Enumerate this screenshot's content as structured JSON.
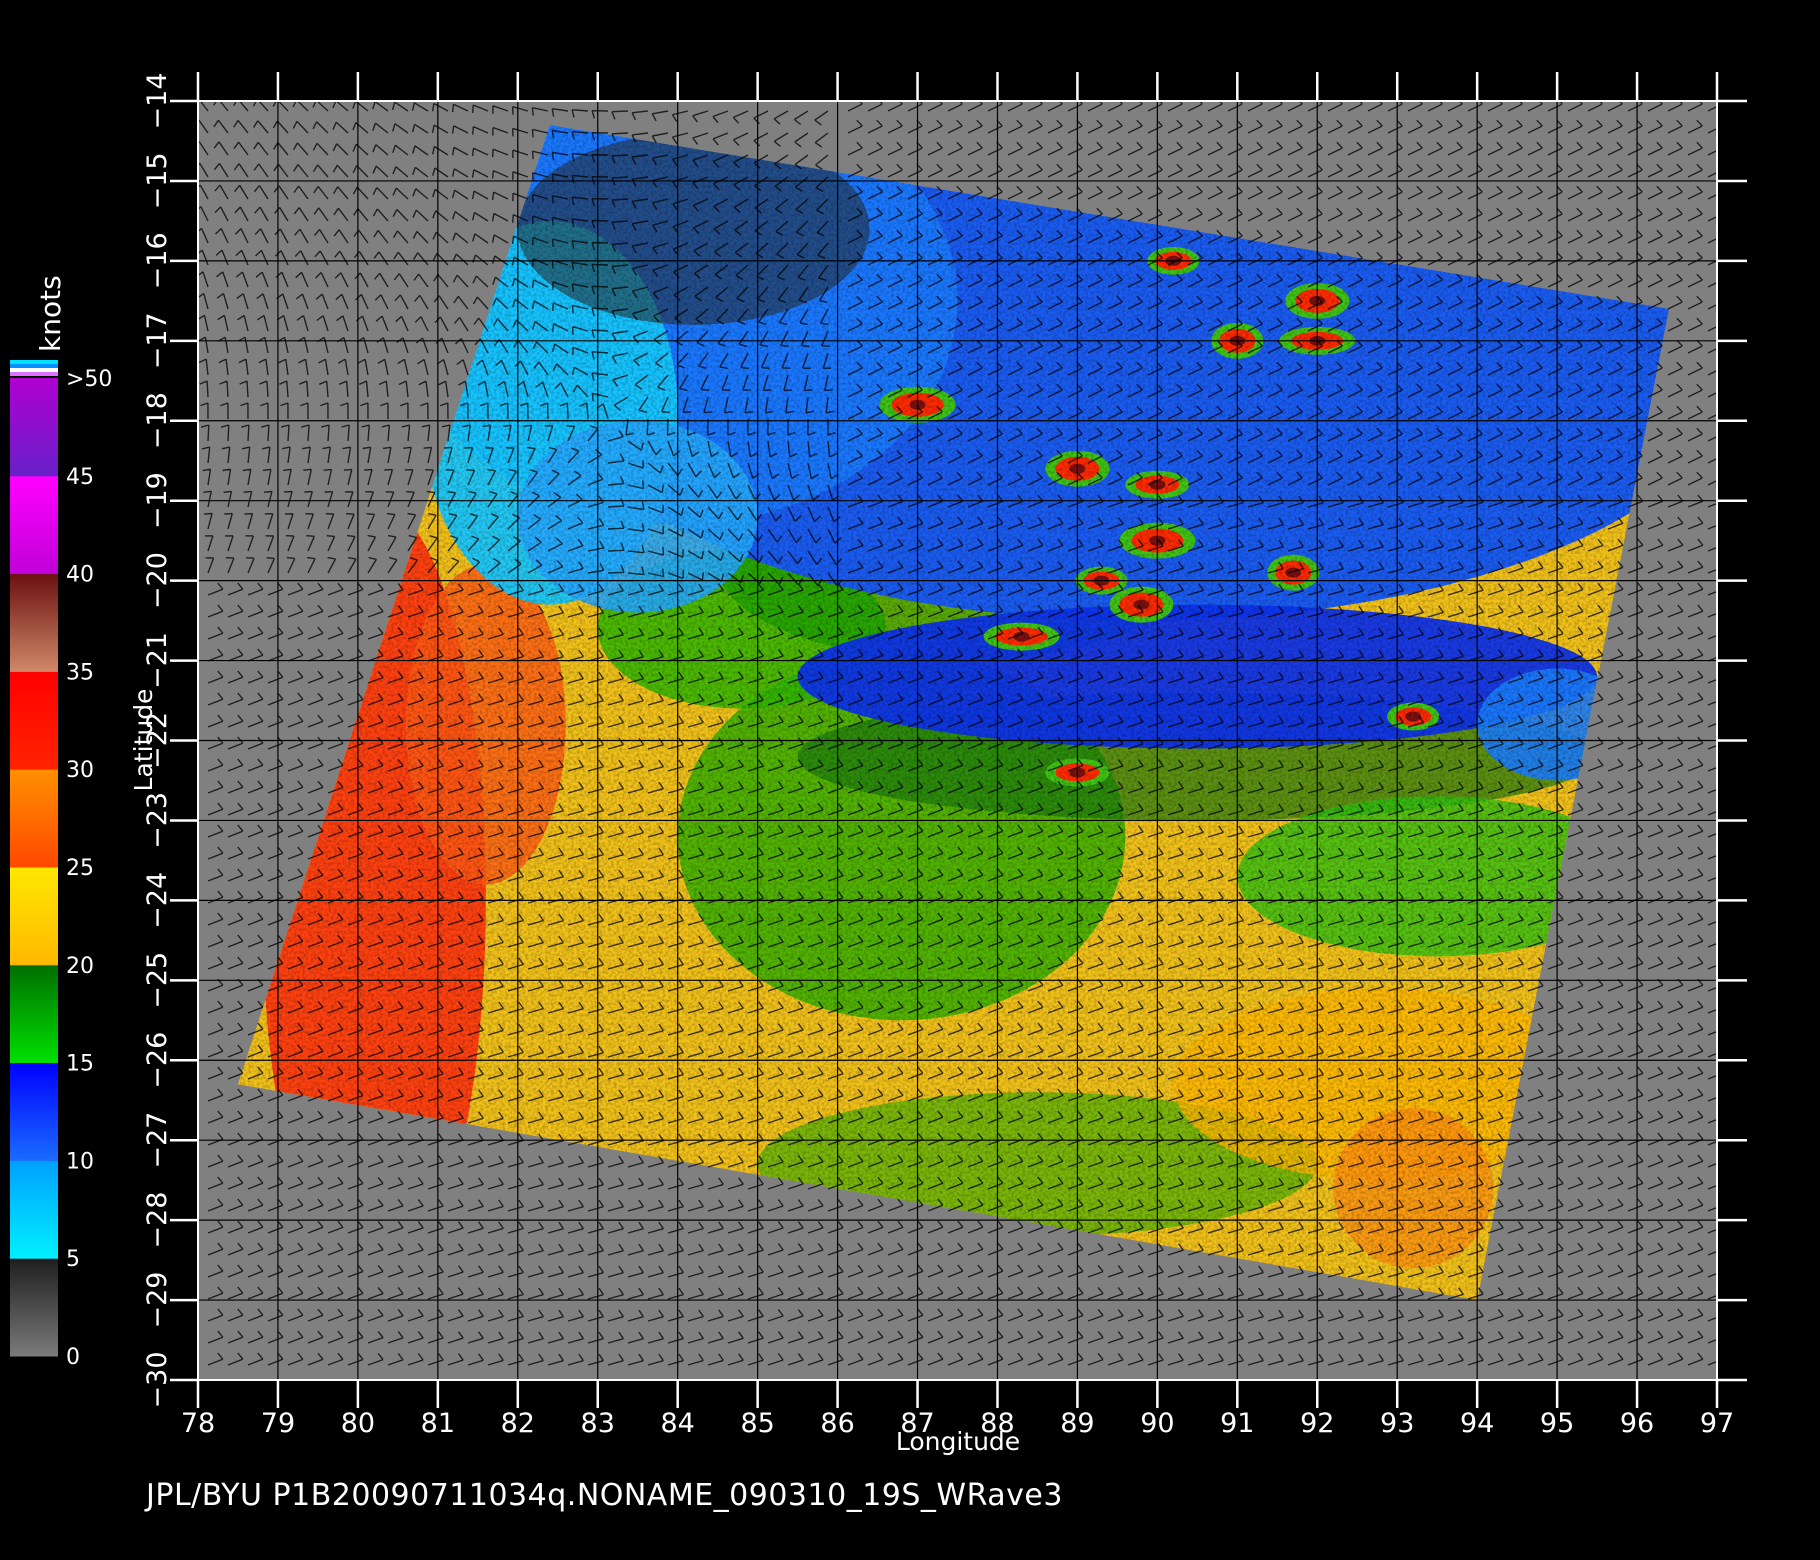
{
  "map": {
    "lon_range": [
      78,
      97
    ],
    "lat_range": [
      -14,
      -30
    ],
    "lon_ticks": [
      78,
      79,
      80,
      81,
      82,
      83,
      84,
      85,
      86,
      87,
      88,
      89,
      90,
      91,
      92,
      93,
      94,
      95,
      96,
      97
    ],
    "lat_ticks": [
      -14,
      -15,
      -16,
      -17,
      -18,
      -19,
      -20,
      -21,
      -22,
      -23,
      -24,
      -25,
      -26,
      -27,
      -28,
      -29,
      -30
    ],
    "lon_tick_labels": [
      "78",
      "79",
      "80",
      "81",
      "82",
      "83",
      "84",
      "85",
      "86",
      "87",
      "88",
      "89",
      "90",
      "91",
      "92",
      "93",
      "94",
      "95",
      "96",
      "97"
    ],
    "lat_tick_labels": [
      "−14",
      "−15",
      "−16",
      "−17",
      "−18",
      "−19",
      "−20",
      "−21",
      "−22",
      "−23",
      "−24",
      "−25",
      "−26",
      "−27",
      "−28",
      "−29",
      "−30"
    ],
    "xlabel": "Longitude",
    "ylabel": "Latitude",
    "background_color": "#808080",
    "swath_corners_lonlat": [
      [
        82.4,
        -14.3
      ],
      [
        96.4,
        -16.6
      ],
      [
        94.0,
        -29.0
      ],
      [
        78.5,
        -26.3
      ]
    ]
  },
  "colorbar": {
    "unit": "knots",
    "labels": [
      ">50",
      "45",
      "40",
      "35",
      "30",
      "25",
      "20",
      "15",
      "10",
      "5",
      "0"
    ],
    "bands": [
      {
        "from": 0,
        "to": 5,
        "top": "#1e1e1e",
        "bottom": "#7a7a7a"
      },
      {
        "from": 5,
        "to": 10,
        "top": "#00a0ff",
        "bottom": "#00f0ff"
      },
      {
        "from": 10,
        "to": 15,
        "top": "#0000ff",
        "bottom": "#1a6cff"
      },
      {
        "from": 15,
        "to": 20,
        "top": "#006e00",
        "bottom": "#00e000"
      },
      {
        "from": 20,
        "to": 25,
        "top": "#ffe800",
        "bottom": "#ffb800"
      },
      {
        "from": 25,
        "to": 30,
        "top": "#ff9000",
        "bottom": "#ff4800"
      },
      {
        "from": 30,
        "to": 35,
        "top": "#ff0000",
        "bottom": "#ff2400"
      },
      {
        "from": 35,
        "to": 40,
        "top": "#6a1010",
        "bottom": "#d08868"
      },
      {
        "from": 40,
        "to": 45,
        "top": "#ff00ff",
        "bottom": "#c000d8"
      },
      {
        "from": 45,
        "to": 50,
        "top": "#b000d0",
        "bottom": "#6820c8"
      }
    ],
    "overflow_colors": [
      "#00e0ff",
      "#0090ff",
      "#ffffff",
      "#e070ff"
    ]
  },
  "footer": {
    "text": "JPL/BYU  P1B20090711034q.NONAME_090310_19S_WRave3"
  }
}
